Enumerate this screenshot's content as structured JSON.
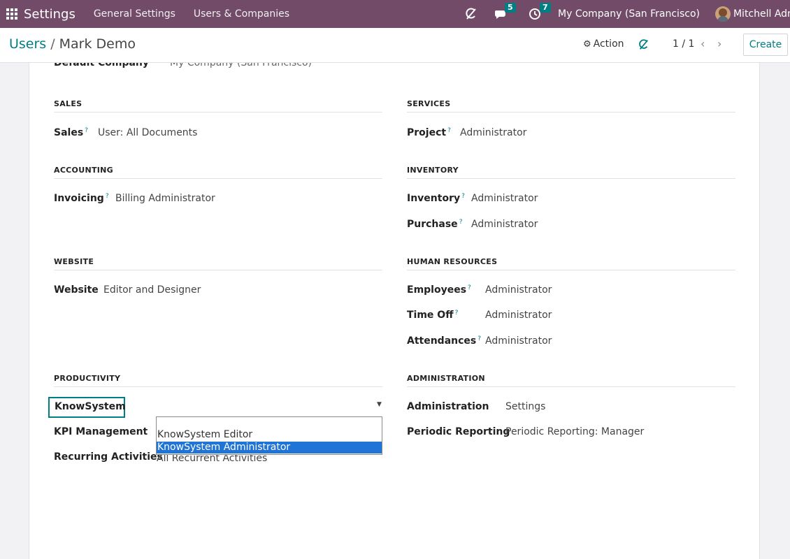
{
  "navbar": {
    "app_name": "Settings",
    "menu": [
      "General Settings",
      "Users & Companies"
    ],
    "messages_count": "5",
    "activities_count": "7",
    "company": "My Company (San Francisco)",
    "user": "Mitchell Admin"
  },
  "control": {
    "breadcrumb_parent": "Users",
    "breadcrumb_sep": "/",
    "breadcrumb_current": "Mark Demo",
    "action_label": "Action",
    "pager": "1 / 1",
    "create_label": "Create"
  },
  "form": {
    "default_company": {
      "label": "Default Company",
      "value": "My Company (San Francisco)"
    },
    "sections": {
      "sales": {
        "title": "SALES",
        "rows": [
          {
            "label": "Sales",
            "value": "User: All Documents"
          }
        ]
      },
      "services": {
        "title": "SERVICES",
        "rows": [
          {
            "label": "Project",
            "value": "Administrator"
          }
        ]
      },
      "accounting": {
        "title": "ACCOUNTING",
        "rows": [
          {
            "label": "Invoicing",
            "value": "Billing Administrator"
          }
        ]
      },
      "inventory": {
        "title": "INVENTORY",
        "rows": [
          {
            "label": "Inventory",
            "value": "Administrator"
          },
          {
            "label": "Purchase",
            "value": "Administrator"
          }
        ]
      },
      "website": {
        "title": "WEBSITE",
        "rows": [
          {
            "label": "Website",
            "value": "Editor and Designer"
          }
        ]
      },
      "hr": {
        "title": "HUMAN RESOURCES",
        "rows": [
          {
            "label": "Employees",
            "value": "Administrator"
          },
          {
            "label": "Time Off",
            "value": "Administrator"
          },
          {
            "label": "Attendances",
            "value": "Administrator"
          }
        ]
      },
      "productivity": {
        "title": "PRODUCTIVITY",
        "rows": [
          {
            "label": "KnowSystem",
            "value": ""
          },
          {
            "label": "KPI Management",
            "value": ""
          },
          {
            "label": "Recurring Activities",
            "value": "All Recurrent Activities"
          }
        ]
      },
      "administration": {
        "title": "ADMINISTRATION",
        "rows": [
          {
            "label": "Administration",
            "value": "Settings"
          },
          {
            "label": "Periodic Reporting",
            "value": "Periodic Reporting: Manager"
          }
        ]
      }
    },
    "help_marker": "?"
  },
  "dropdown": {
    "options": [
      "",
      "KnowSystem Editor",
      "KnowSystem Administrator"
    ],
    "selected": "KnowSystem Administrator"
  },
  "colors": {
    "navbar": "#714b67",
    "accent": "#017e84",
    "selection": "#1f74d6"
  },
  "icons": [
    "apps-grid-icon",
    "refresh-icon",
    "chat-icon",
    "clock-icon",
    "gear-icon",
    "chevron-left-icon",
    "chevron-right-icon",
    "caret-down-icon"
  ]
}
